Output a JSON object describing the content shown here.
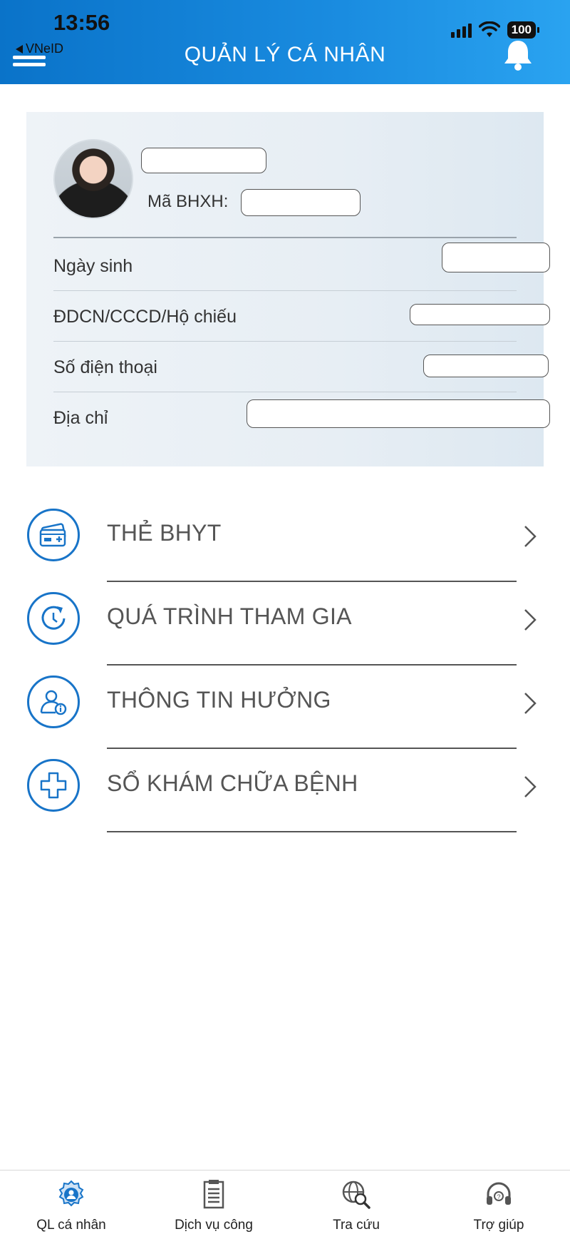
{
  "status_bar": {
    "time": "13:56",
    "battery": "100",
    "back_app": "VNeID"
  },
  "header": {
    "title": "QUẢN LÝ CÁ NHÂN"
  },
  "profile": {
    "bhxh_label": "Mã BHXH:",
    "fields": [
      {
        "label": "Ngày sinh"
      },
      {
        "label": "ĐDCN/CCCD/Hộ chiếu"
      },
      {
        "label": "Số điện thoại"
      },
      {
        "label": "Địa chỉ"
      }
    ]
  },
  "menu": [
    {
      "label": "THẺ BHYT",
      "icon": "health-card-icon"
    },
    {
      "label": "QUÁ TRÌNH THAM GIA",
      "icon": "history-refresh-icon"
    },
    {
      "label": "THÔNG TIN HƯỞNG",
      "icon": "user-info-icon"
    },
    {
      "label": "SỔ KHÁM CHỮA BỆNH",
      "icon": "medical-cross-icon"
    }
  ],
  "bottom_nav": [
    {
      "label": "QL cá nhân",
      "icon": "personal-gear-icon",
      "active": true
    },
    {
      "label": "Dịch vụ công",
      "icon": "document-icon",
      "active": false
    },
    {
      "label": "Tra cứu",
      "icon": "globe-search-icon",
      "active": false
    },
    {
      "label": "Trợ giúp",
      "icon": "headset-icon",
      "active": false
    }
  ],
  "colors": {
    "primary": "#1874c8",
    "header_start": "#0a73c9",
    "header_end": "#2aa3f0",
    "card_bg": "#e7eef4"
  }
}
